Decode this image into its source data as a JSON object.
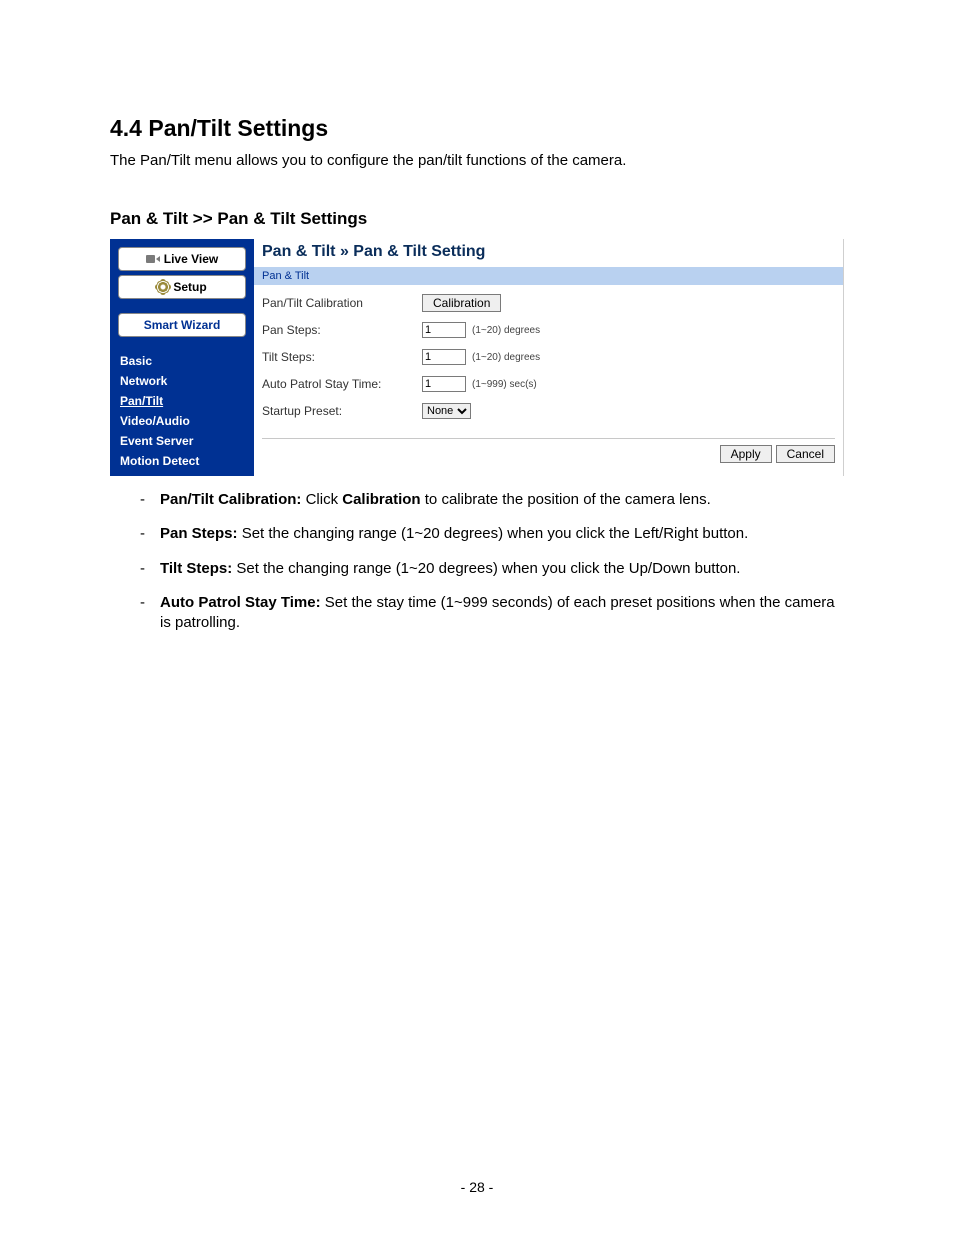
{
  "doc": {
    "section_title": "4.4  Pan/Tilt Settings",
    "intro": "The Pan/Tilt menu allows you to configure the pan/tilt functions of the camera.",
    "sub_title": "Pan & Tilt >> Pan & Tilt Settings",
    "page_number": "- 28 -"
  },
  "ui": {
    "left": {
      "live_view": "Live View",
      "setup": "Setup",
      "smart_wizard": "Smart Wizard",
      "items": [
        {
          "label": "Basic",
          "active": false
        },
        {
          "label": "Network",
          "active": false
        },
        {
          "label": "Pan/Tilt",
          "active": true
        },
        {
          "label": "Video/Audio",
          "active": false
        },
        {
          "label": "Event Server",
          "active": false
        },
        {
          "label": "Motion Detect",
          "active": false
        }
      ]
    },
    "right": {
      "breadcrumb": "Pan & Tilt » Pan & Tilt Setting",
      "section_bar": "Pan & Tilt",
      "rows": {
        "calibration": {
          "label": "Pan/Tilt Calibration",
          "button": "Calibration"
        },
        "pan_steps": {
          "label": "Pan Steps:",
          "value": "1",
          "hint": "(1~20) degrees"
        },
        "tilt_steps": {
          "label": "Tilt Steps:",
          "value": "1",
          "hint": "(1~20) degrees"
        },
        "auto_patrol": {
          "label": "Auto Patrol Stay Time:",
          "value": "1",
          "hint": "(1~999) sec(s)"
        },
        "startup_preset": {
          "label": "Startup Preset:",
          "value": "None"
        }
      },
      "actions": {
        "apply": "Apply",
        "cancel": "Cancel"
      }
    }
  },
  "bullets": [
    {
      "term": "Pan/Tilt Calibration:",
      "pre": " Click ",
      "bold_mid": "Calibration",
      "post": " to calibrate the position of the camera lens."
    },
    {
      "term": "Pan Steps:",
      "pre": " Set the changing range (1~20 degrees) when you click the Left/Right button.",
      "bold_mid": "",
      "post": ""
    },
    {
      "term": "Tilt Steps:",
      "pre": " Set the changing range (1~20 degrees) when you click the Up/Down button.",
      "bold_mid": "",
      "post": ""
    },
    {
      "term": "Auto Patrol Stay Time:",
      "pre": " Set the stay time (1~999 seconds) of each preset positions when the camera is patrolling.",
      "bold_mid": "",
      "post": ""
    }
  ]
}
